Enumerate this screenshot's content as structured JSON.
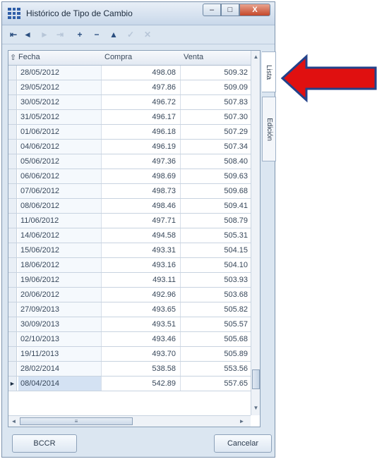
{
  "window": {
    "title": "Histórico de Tipo de Cambio",
    "controls": {
      "minimize": "–",
      "maximize": "□",
      "close": "X"
    }
  },
  "navigator": {
    "buttons": [
      {
        "name": "first-record-button",
        "icon": "⇤",
        "enabled": true
      },
      {
        "name": "prior-record-button",
        "icon": "◄",
        "enabled": true
      },
      {
        "name": "next-record-button",
        "icon": "►",
        "enabled": false
      },
      {
        "name": "last-record-button",
        "icon": "⇥",
        "enabled": false
      },
      {
        "name": "insert-record-button",
        "icon": "+",
        "enabled": true
      },
      {
        "name": "delete-record-button",
        "icon": "−",
        "enabled": true
      },
      {
        "name": "edit-record-button",
        "icon": "▲",
        "enabled": true
      },
      {
        "name": "post-record-button",
        "icon": "✓",
        "enabled": false
      },
      {
        "name": "cancel-edit-button",
        "icon": "✕",
        "enabled": false
      }
    ]
  },
  "grid": {
    "columns": [
      "Fecha",
      "Compra",
      "Venta"
    ],
    "sort_indicator": "⇧",
    "rows": [
      {
        "fecha": "28/05/2012",
        "compra": "498.08",
        "venta": "509.32"
      },
      {
        "fecha": "29/05/2012",
        "compra": "497.86",
        "venta": "509.09"
      },
      {
        "fecha": "30/05/2012",
        "compra": "496.72",
        "venta": "507.83"
      },
      {
        "fecha": "31/05/2012",
        "compra": "496.17",
        "venta": "507.30"
      },
      {
        "fecha": "01/06/2012",
        "compra": "496.18",
        "venta": "507.29"
      },
      {
        "fecha": "04/06/2012",
        "compra": "496.19",
        "venta": "507.34"
      },
      {
        "fecha": "05/06/2012",
        "compra": "497.36",
        "venta": "508.40"
      },
      {
        "fecha": "06/06/2012",
        "compra": "498.69",
        "venta": "509.63"
      },
      {
        "fecha": "07/06/2012",
        "compra": "498.73",
        "venta": "509.68"
      },
      {
        "fecha": "08/06/2012",
        "compra": "498.46",
        "venta": "509.41"
      },
      {
        "fecha": "11/06/2012",
        "compra": "497.71",
        "venta": "508.79"
      },
      {
        "fecha": "14/06/2012",
        "compra": "494.58",
        "venta": "505.31"
      },
      {
        "fecha": "15/06/2012",
        "compra": "493.31",
        "venta": "504.15"
      },
      {
        "fecha": "18/06/2012",
        "compra": "493.16",
        "venta": "504.10"
      },
      {
        "fecha": "19/06/2012",
        "compra": "493.11",
        "venta": "503.93"
      },
      {
        "fecha": "20/06/2012",
        "compra": "492.96",
        "venta": "503.68"
      },
      {
        "fecha": "27/09/2013",
        "compra": "493.65",
        "venta": "505.82"
      },
      {
        "fecha": "30/09/2013",
        "compra": "493.51",
        "venta": "505.57"
      },
      {
        "fecha": "02/10/2013",
        "compra": "493.46",
        "venta": "505.68"
      },
      {
        "fecha": "19/11/2013",
        "compra": "493.70",
        "venta": "505.89"
      },
      {
        "fecha": "28/02/2014",
        "compra": "538.58",
        "venta": "553.56"
      },
      {
        "fecha": "08/04/2014",
        "compra": "542.89",
        "venta": "557.65"
      }
    ],
    "current_row": 21,
    "current_row_marker": "►"
  },
  "tabs": [
    {
      "label": "Lista",
      "active": true
    },
    {
      "label": "Edición",
      "active": false
    }
  ],
  "buttons": {
    "bccr": "BCCR",
    "cancel": "Cancelar"
  },
  "colors": {
    "accent_arrow": "#e01010",
    "window_bg": "#dbe6f1"
  }
}
